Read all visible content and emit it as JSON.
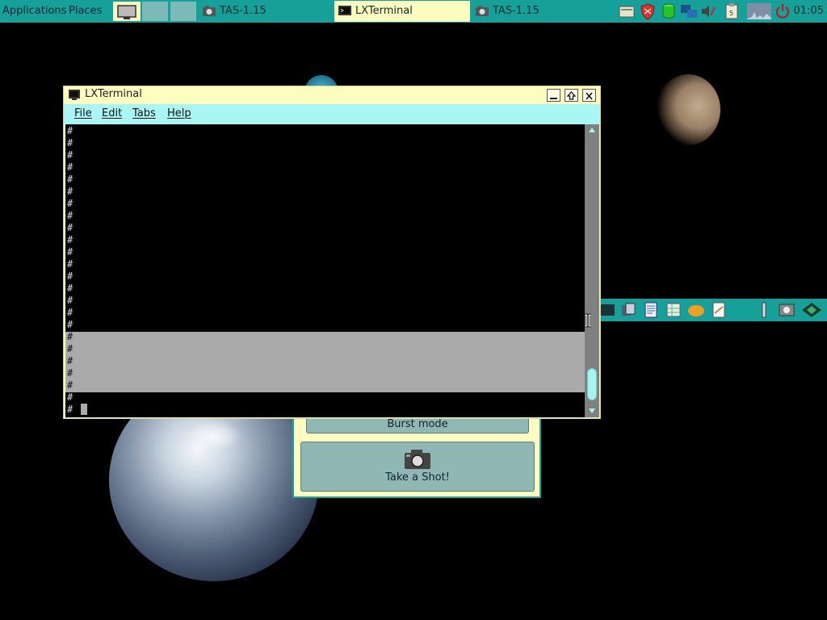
{
  "top_panel": {
    "applications_label": "Applications",
    "places_label": "Places",
    "tasks": [
      {
        "label": "TAS-1.15"
      },
      {
        "label": "LXTerminal"
      },
      {
        "label": "TAS-1.15"
      }
    ],
    "clock": "01:05",
    "colors": {
      "panel": "#16a09a",
      "active_task": "#fdfdc0"
    }
  },
  "tas_window": {
    "burst_label": "Burst mode",
    "shot_label": "Take a Shot!"
  },
  "terminal": {
    "title": "LXTerminal",
    "menu": {
      "file": "File",
      "edit": "Edit",
      "tabs": "Tabs",
      "help": "Help"
    },
    "lines": [
      "#",
      "#",
      "#",
      "#",
      "#",
      "#",
      "#",
      "#",
      "#",
      "#",
      "#",
      "#",
      "#",
      "#",
      "#",
      "#",
      "#",
      "#",
      "#",
      "#",
      "#",
      "#",
      "#",
      "#"
    ],
    "colors": {
      "title_bg": "#fdfdc0",
      "menubar_bg": "#a9f7f5",
      "selection": "#aaaaaa"
    }
  },
  "icons": {
    "top_launchers": [
      "show-desktop-icon",
      "window-button-icon",
      "window-button-icon"
    ],
    "tray": [
      "file-manager-icon",
      "shield-icon",
      "database-icon",
      "network-icon",
      "volume-icon",
      "clipboard-icon",
      "cpu-graph-icon",
      "power-icon"
    ],
    "dock": [
      "terminal-icon",
      "files-icon",
      "document-icon",
      "spreadsheet-icon",
      "paint-icon",
      "text-editor-icon",
      "settings-icon",
      "screenshot-icon",
      "app-icon"
    ]
  }
}
